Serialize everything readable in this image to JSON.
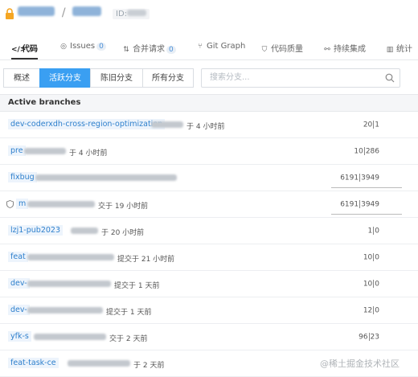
{
  "project": {
    "id_label": "ID:"
  },
  "tabs": [
    {
      "label": "代码",
      "icon": "code-icon",
      "active": true
    },
    {
      "label": "Issues",
      "icon": "issues-icon",
      "badge": "0"
    },
    {
      "label": "合并请求",
      "icon": "merge-request-icon",
      "badge": "0"
    },
    {
      "label": "Git Graph",
      "icon": "git-graph-icon"
    },
    {
      "label": "代码质量",
      "icon": "shield-icon"
    },
    {
      "label": "持续集成",
      "icon": "ci-icon"
    },
    {
      "label": "统计",
      "icon": "chart-icon"
    }
  ],
  "branch_filters": [
    "概述",
    "活跃分支",
    "陈旧分支",
    "所有分支"
  ],
  "active_filter": "活跃分支",
  "search": {
    "placeholder": "搜索分支..."
  },
  "list_header": "Active branches",
  "branches": [
    {
      "name": "dev-coderxdh-cross-region-optimization",
      "meta": "于 4 小时前",
      "ahead": "20",
      "behind": "1"
    },
    {
      "name": "pre",
      "meta": "于 4 小时前",
      "ahead": "10",
      "behind": "286"
    },
    {
      "name": "fixbug",
      "meta": "",
      "ahead": "6191",
      "behind": "3949",
      "bar": true
    },
    {
      "name": "m",
      "meta": "交于 19 小时前",
      "ahead": "6191",
      "behind": "3949",
      "bar": true,
      "protected": true
    },
    {
      "name": "lzj1-pub2023",
      "meta": "于 20 小时前",
      "ahead": "1",
      "behind": "0"
    },
    {
      "name": "feat",
      "meta": "提交于 21 小时前",
      "ahead": "10",
      "behind": "0"
    },
    {
      "name": "dev-",
      "meta": "提交于 1 天前",
      "ahead": "10",
      "behind": "0"
    },
    {
      "name": "dev-",
      "meta": "提交于 1 天前",
      "ahead": "12",
      "behind": "0"
    },
    {
      "name": "yfk-s",
      "meta": "交于 2 天前",
      "ahead": "96",
      "behind": "23"
    },
    {
      "name": "feat-task-ce",
      "meta": "于 2 天前",
      "ahead": "",
      "behind": ""
    }
  ],
  "watermark": "@稀土掘金技术社区",
  "colors": {
    "accent": "#3a9ff2",
    "link": "#2d7fcc",
    "lock": "#f5a623"
  }
}
